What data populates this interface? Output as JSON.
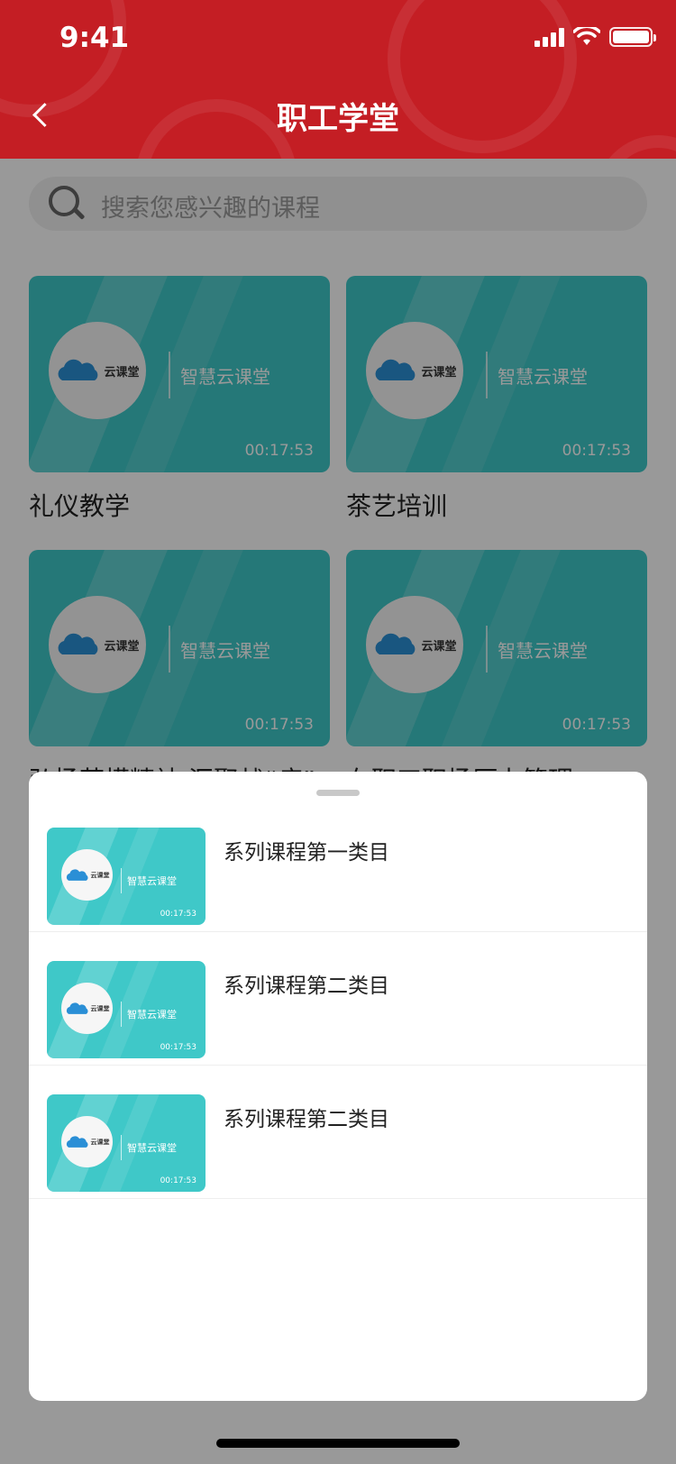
{
  "status_bar": {
    "time": "9:41"
  },
  "header": {
    "title": "职工学堂"
  },
  "search": {
    "placeholder": "搜索您感兴趣的课程"
  },
  "thumbnail": {
    "brand": "智慧云课堂",
    "logo_text": "云课堂",
    "duration": "00:17:53"
  },
  "courses": [
    {
      "title": "礼仪教学"
    },
    {
      "title": "茶艺培训"
    },
    {
      "title": "弘扬劳模精神 汇聚战“疫”"
    },
    {
      "title": "在职工职场压力管理"
    }
  ],
  "sheet": {
    "items": [
      {
        "label": "系列课程第一类目"
      },
      {
        "label": "系列课程第二类目"
      },
      {
        "label": "系列课程第二类目"
      }
    ]
  },
  "colors": {
    "header": "#c41e24",
    "thumb": "#3fc8c8",
    "overlay": "rgba(0,0,0,0.4)"
  }
}
